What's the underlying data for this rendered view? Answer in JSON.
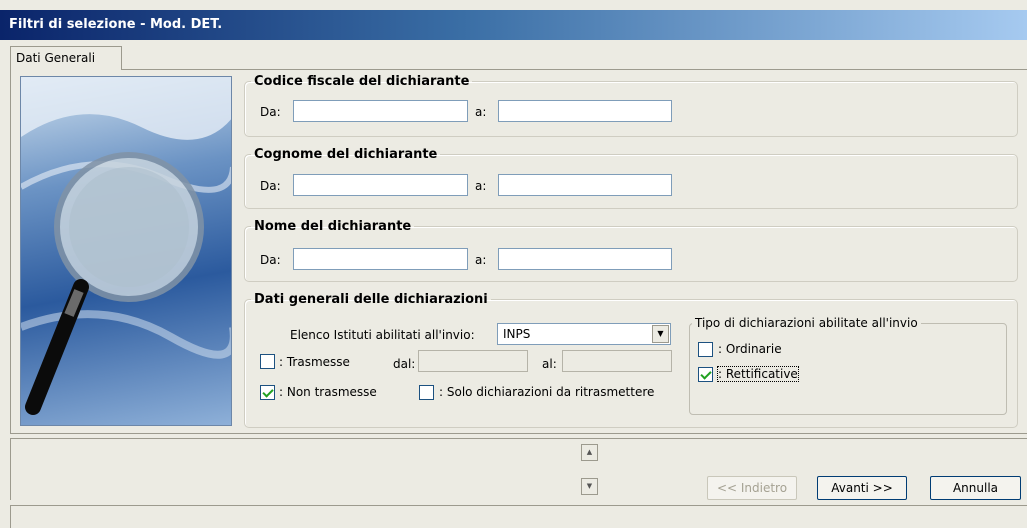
{
  "window": {
    "title": "Filtri di selezione - Mod. DET."
  },
  "tabs": [
    {
      "label": "Dati Generali"
    }
  ],
  "codice_fiscale": {
    "legend": "Codice fiscale del dichiarante",
    "from_label": "Da:",
    "from_value": "",
    "to_label": "a:",
    "to_value": ""
  },
  "cognome": {
    "legend": "Cognome del dichiarante",
    "from_label": "Da:",
    "from_value": "",
    "to_label": "a:",
    "to_value": ""
  },
  "nome": {
    "legend": "Nome del dichiarante",
    "from_label": "Da:",
    "from_value": "",
    "to_label": "a:",
    "to_value": ""
  },
  "dati_generali": {
    "legend": "Dati generali delle dichiarazioni",
    "istituti_label": "Elenco Istituti abilitati all'invio:",
    "istituti_value": "INPS",
    "trasmesse": {
      "label": ": Trasmesse",
      "checked": false
    },
    "dal_label": "dal:",
    "dal_value": "",
    "al_label": "al:",
    "al_value": "",
    "non_trasmesse": {
      "label": ": Non trasmesse",
      "checked": true
    },
    "solo_ritrasmettere": {
      "label": ": Solo dichiarazioni da ritrasmettere",
      "checked": false
    },
    "tipo": {
      "legend": "Tipo di dichiarazioni abilitate all'invio",
      "ordinarie": {
        "label": ": Ordinarie",
        "checked": false
      },
      "rettificative": {
        "label": ": Rettificative",
        "checked": true
      }
    }
  },
  "buttons": {
    "back": "<< Indietro",
    "next": "Avanti >>",
    "cancel": "Annulla"
  },
  "icons": {
    "scroll_up": "up-arrow-icon",
    "scroll_down": "down-arrow-icon",
    "dropdown": "chevron-down-icon",
    "illustration": "magnifying-glass-icon"
  },
  "colors": {
    "title_bar_start": "#0a246a",
    "title_bar_end": "#a6caf0",
    "window_bg": "#ecebe3",
    "check_green": "#21a121"
  }
}
